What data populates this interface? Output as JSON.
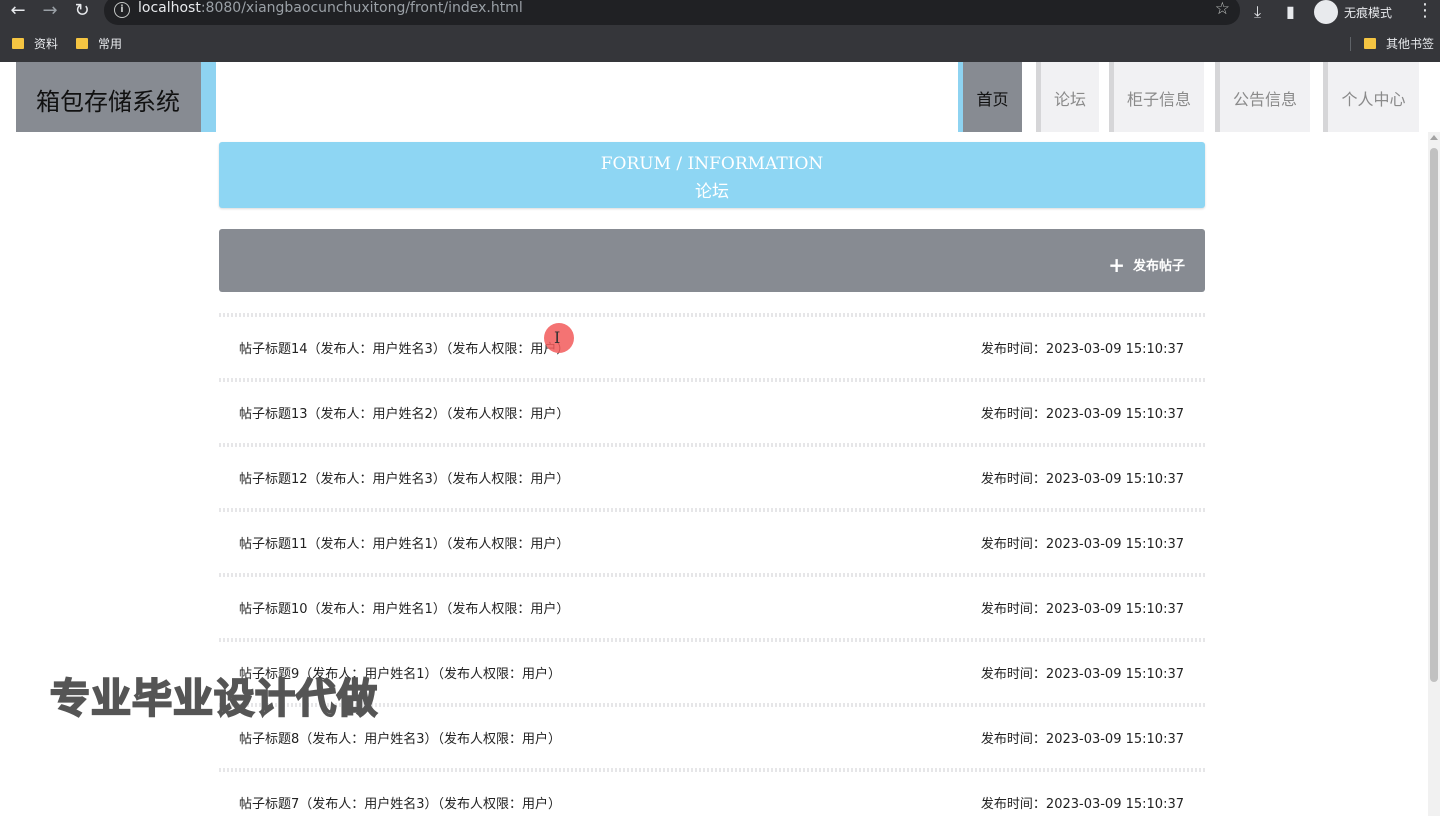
{
  "browser": {
    "url_host": "localhost",
    "url_path": ":8080/xiangbaocunchuxitong/front/index.html",
    "incognito_label": "无痕模式",
    "bookmarks": [
      "资料",
      "常用"
    ],
    "other_bookmarks": "其他书签"
  },
  "header": {
    "logo": "箱包存储系统",
    "nav": [
      {
        "label": "首页",
        "active": true
      },
      {
        "label": "论坛",
        "active": false
      },
      {
        "label": "柜子信息",
        "active": false
      },
      {
        "label": "公告信息",
        "active": false
      },
      {
        "label": "个人中心",
        "active": false
      }
    ]
  },
  "banner": {
    "en": "FORUM / INFORMATION",
    "cn": "论坛"
  },
  "actions": {
    "publish": "发布帖子"
  },
  "posts": [
    {
      "title": "帖子标题14（发布人：用户姓名3）（发布人权限：用户）",
      "time": "发布时间：2023-03-09 15:10:37"
    },
    {
      "title": "帖子标题13（发布人：用户姓名2）（发布人权限：用户）",
      "time": "发布时间：2023-03-09 15:10:37"
    },
    {
      "title": "帖子标题12（发布人：用户姓名3）（发布人权限：用户）",
      "time": "发布时间：2023-03-09 15:10:37"
    },
    {
      "title": "帖子标题11（发布人：用户姓名1）（发布人权限：用户）",
      "time": "发布时间：2023-03-09 15:10:37"
    },
    {
      "title": "帖子标题10（发布人：用户姓名1）（发布人权限：用户）",
      "time": "发布时间：2023-03-09 15:10:37"
    },
    {
      "title": "帖子标题9（发布人：用户姓名1）（发布人权限：用户）",
      "time": "发布时间：2023-03-09 15:10:37"
    },
    {
      "title": "帖子标题8（发布人：用户姓名3）（发布人权限：用户）",
      "time": "发布时间：2023-03-09 15:10:37"
    },
    {
      "title": "帖子标题7（发布人：用户姓名3）（发布人权限：用户）",
      "time": "发布时间：2023-03-09 15:10:37"
    }
  ],
  "overlay": {
    "watermark": "专业毕业设计代做"
  },
  "colors": {
    "accent": "#8ed3f1",
    "header_gray": "#878b92",
    "nav_bg": "#f1f1f3"
  }
}
